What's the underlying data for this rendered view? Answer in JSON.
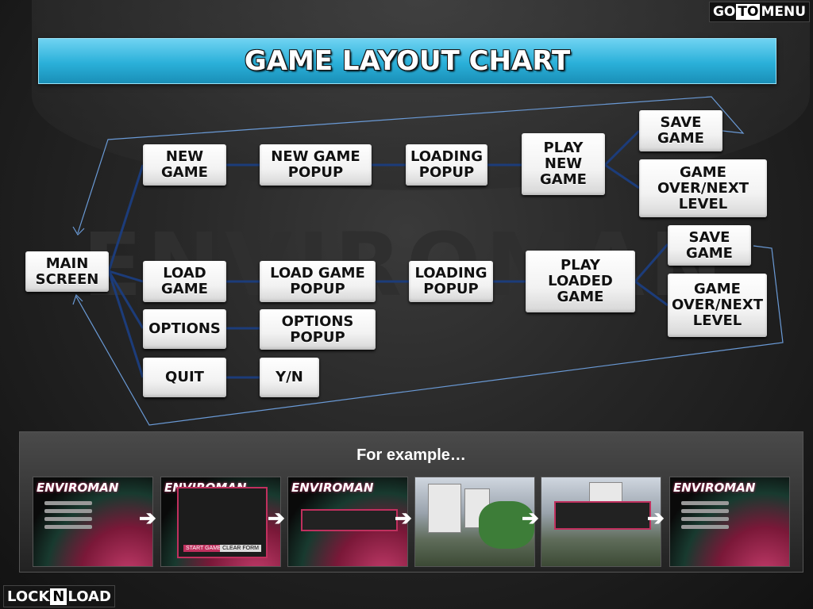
{
  "nav": {
    "goto_left": "GO",
    "goto_highlight": "TO",
    "goto_right": "MENU"
  },
  "banner": {
    "title": "GAME LAYOUT CHART"
  },
  "watermark": "ENVIROMAN",
  "diagram": {
    "nodes": {
      "main_screen": "MAIN\nSCREEN",
      "new_game": "NEW\nGAME",
      "new_game_popup": "NEW GAME\nPOPUP",
      "loading_popup_1": "LOADING\nPOPUP",
      "play_new_game": "PLAY\nNEW\nGAME",
      "save_game_1": "SAVE\nGAME",
      "game_over_1": "GAME\nOVER/NEXT\nLEVEL",
      "load_game": "LOAD\nGAME",
      "load_game_popup": "LOAD GAME\nPOPUP",
      "loading_popup_2": "LOADING\nPOPUP",
      "play_loaded_game": "PLAY\nLOADED\nGAME",
      "save_game_2": "SAVE\nGAME",
      "game_over_2": "GAME\nOVER/NEXT\nLEVEL",
      "options": "OPTIONS",
      "options_popup": "OPTIONS\nPOPUP",
      "quit": "QUIT",
      "yn": "Y/N"
    },
    "edges": [
      [
        "main_screen",
        "new_game"
      ],
      [
        "main_screen",
        "load_game"
      ],
      [
        "main_screen",
        "options"
      ],
      [
        "main_screen",
        "quit"
      ],
      [
        "new_game",
        "new_game_popup"
      ],
      [
        "new_game_popup",
        "loading_popup_1"
      ],
      [
        "loading_popup_1",
        "play_new_game"
      ],
      [
        "play_new_game",
        "save_game_1"
      ],
      [
        "play_new_game",
        "game_over_1"
      ],
      [
        "load_game",
        "load_game_popup"
      ],
      [
        "load_game_popup",
        "loading_popup_2"
      ],
      [
        "loading_popup_2",
        "play_loaded_game"
      ],
      [
        "play_loaded_game",
        "save_game_2"
      ],
      [
        "play_loaded_game",
        "game_over_2"
      ],
      [
        "options",
        "options_popup"
      ],
      [
        "quit",
        "yn"
      ],
      [
        "save_game_1",
        "main_screen"
      ],
      [
        "save_game_2",
        "main_screen"
      ]
    ]
  },
  "example": {
    "label": "For example…",
    "screens": [
      "main-menu",
      "new-game-dialog",
      "loading-screen",
      "gameplay",
      "save-game-dialog",
      "main-menu"
    ],
    "logo_text": "ENVIROMAN",
    "dialog_buttons": {
      "start": "START GAME",
      "clear": "CLEAR FORM"
    }
  },
  "brand": {
    "left": "LOCK",
    "highlight": "N",
    "right": "LOAD"
  },
  "colors": {
    "banner": "#2ab0d9",
    "connector": "#1c3c7a",
    "feedback_line": "#6a9ad6",
    "accent": "#c0305e"
  }
}
